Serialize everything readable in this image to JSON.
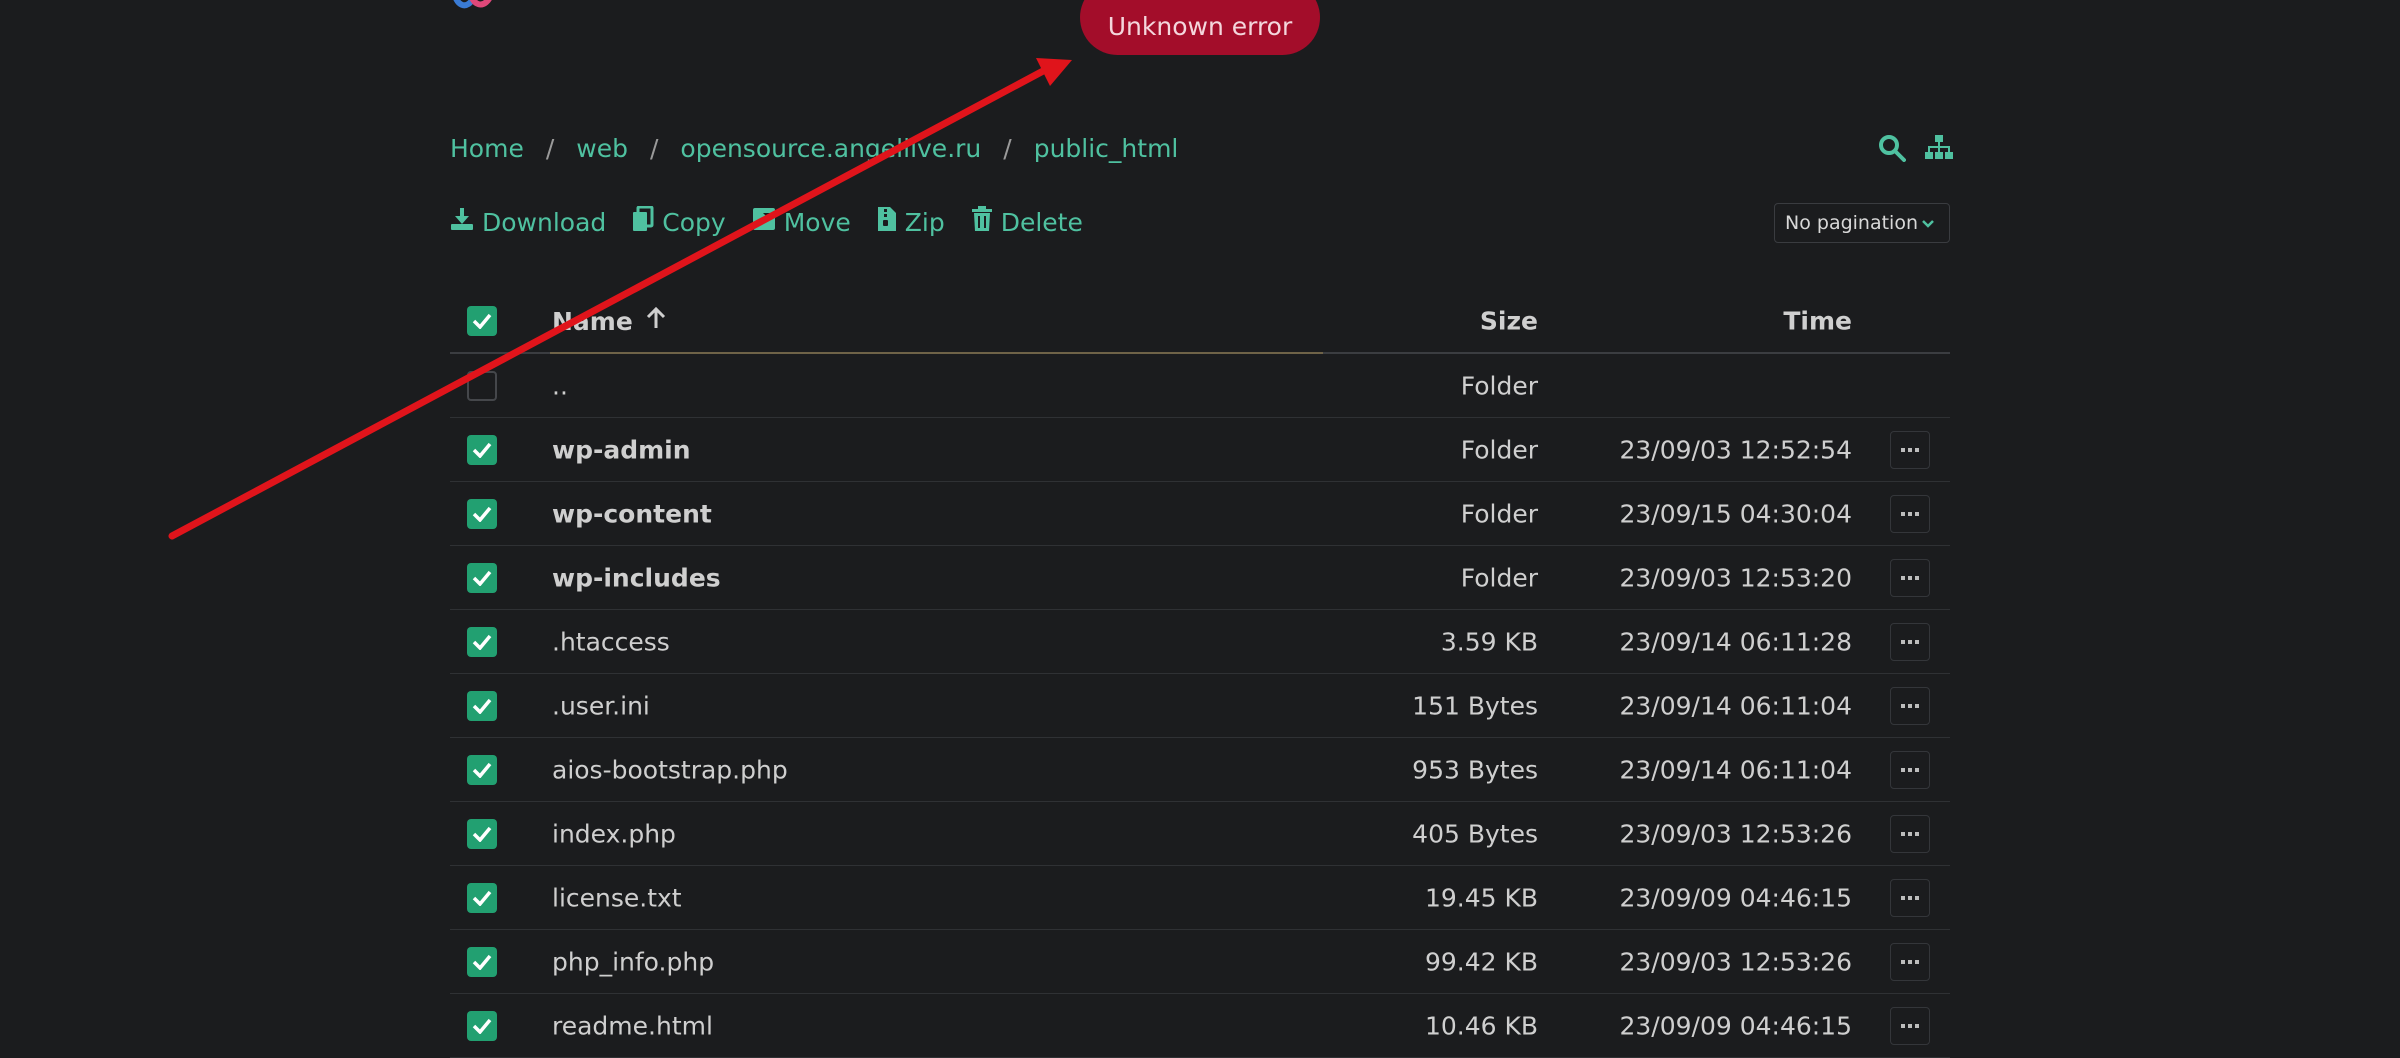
{
  "toast": {
    "message": "Unknown error"
  },
  "breadcrumb": {
    "items": [
      {
        "label": "Home"
      },
      {
        "label": "web"
      },
      {
        "label": "opensource.angellive.ru"
      },
      {
        "label": "public_html"
      }
    ],
    "separator": "/"
  },
  "toolbar": {
    "download_label": "Download",
    "copy_label": "Copy",
    "move_label": "Move",
    "zip_label": "Zip",
    "delete_label": "Delete"
  },
  "pagination": {
    "selected": "No pagination"
  },
  "table": {
    "headers": {
      "name": "Name",
      "size": "Size",
      "time": "Time"
    },
    "rows": [
      {
        "name": "..",
        "size": "Folder",
        "time": "",
        "checked": false,
        "bold": false,
        "menu": false
      },
      {
        "name": "wp-admin",
        "size": "Folder",
        "time": "23/09/03 12:52:54",
        "checked": true,
        "bold": true,
        "menu": true
      },
      {
        "name": "wp-content",
        "size": "Folder",
        "time": "23/09/15 04:30:04",
        "checked": true,
        "bold": true,
        "menu": true
      },
      {
        "name": "wp-includes",
        "size": "Folder",
        "time": "23/09/03 12:53:20",
        "checked": true,
        "bold": true,
        "menu": true
      },
      {
        "name": ".htaccess",
        "size": "3.59 KB",
        "time": "23/09/14 06:11:28",
        "checked": true,
        "bold": false,
        "menu": true
      },
      {
        "name": ".user.ini",
        "size": "151 Bytes",
        "time": "23/09/14 06:11:04",
        "checked": true,
        "bold": false,
        "menu": true
      },
      {
        "name": "aios-bootstrap.php",
        "size": "953 Bytes",
        "time": "23/09/14 06:11:04",
        "checked": true,
        "bold": false,
        "menu": true
      },
      {
        "name": "index.php",
        "size": "405 Bytes",
        "time": "23/09/03 12:53:26",
        "checked": true,
        "bold": false,
        "menu": true
      },
      {
        "name": "license.txt",
        "size": "19.45 KB",
        "time": "23/09/09 04:46:15",
        "checked": true,
        "bold": false,
        "menu": true
      },
      {
        "name": "php_info.php",
        "size": "99.42 KB",
        "time": "23/09/03 12:53:26",
        "checked": true,
        "bold": false,
        "menu": true
      },
      {
        "name": "readme.html",
        "size": "10.46 KB",
        "time": "23/09/09 04:46:15",
        "checked": true,
        "bold": false,
        "menu": true
      }
    ]
  },
  "colors": {
    "accent": "#4fc1a0",
    "checkbox": "#22a071",
    "toast": "#a30d2a",
    "background": "#1b1c1e",
    "annotation_arrow": "#e0141b"
  }
}
